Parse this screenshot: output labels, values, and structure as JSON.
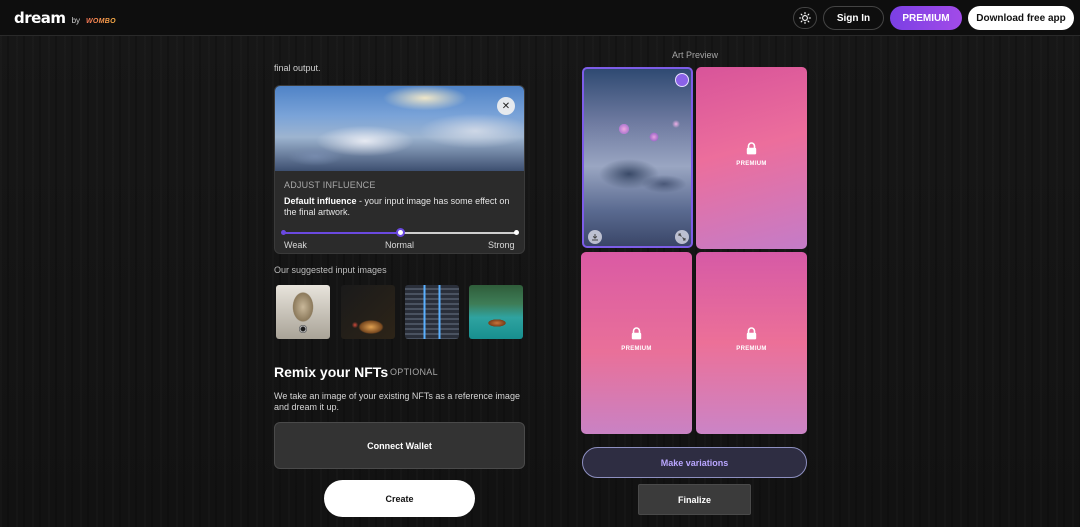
{
  "header": {
    "logo_text": "dream",
    "logo_by": "by",
    "logo_brand": "WOMBO",
    "signin_label": "Sign In",
    "premium_label": "PREMIUM",
    "download_label": "Download free app",
    "theme_icon": "sun-icon"
  },
  "left": {
    "truncated_text": "final output.",
    "influence": {
      "title": "ADJUST INFLUENCE",
      "desc_bold": "Default influence",
      "desc_rest": " - your input image has some effect on the final artwork.",
      "slider_labels": [
        "Weak",
        "Normal",
        "Strong"
      ],
      "slider_value": 0.5,
      "close_icon": "close-icon"
    },
    "suggested_title": "Our suggested input images",
    "suggested_images": [
      "owl",
      "food",
      "escalator",
      "boat"
    ],
    "remix": {
      "title": "Remix your NFTs",
      "optional": "OPTIONAL",
      "desc": "We take an image of your existing NFTs as a reference image and dream it up.",
      "connect_label": "Connect Wallet"
    },
    "create_label": "Create"
  },
  "right": {
    "preview_title": "Art Preview",
    "tiles": [
      {
        "locked": false
      },
      {
        "locked": true,
        "label": "PREMIUM"
      },
      {
        "locked": true,
        "label": "PREMIUM"
      },
      {
        "locked": true,
        "label": "PREMIUM"
      }
    ],
    "variations_label": "Make variations",
    "finalize_label": "Finalize"
  },
  "colors": {
    "accent_purple": "#7b3fe4",
    "slider_fill": "#6a49e0",
    "premium_pink": "#e86b9a"
  }
}
